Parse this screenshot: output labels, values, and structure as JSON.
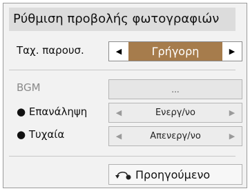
{
  "dialog": {
    "title": "Ρύθμιση προβολής φωτογραφιών"
  },
  "speed": {
    "label": "Ταχ. παρουσ.",
    "value": "Γρήγορη",
    "left_icon": "triangle-left-icon",
    "right_icon": "triangle-right-icon"
  },
  "bgm": {
    "label": "BGM",
    "value": "..."
  },
  "repeat": {
    "label": "● Επανάληψη",
    "value": "Ενεργ/νο"
  },
  "shuffle": {
    "label": "● Τυχαία",
    "value": "Απενεργ/νο"
  },
  "back_button": {
    "label": "Προηγούμενο",
    "icon": "back-return-icon"
  },
  "colors": {
    "accent": "#a67c4c",
    "title_bg": "#dcdcdc",
    "panel_bg": "#f2f2f2"
  }
}
